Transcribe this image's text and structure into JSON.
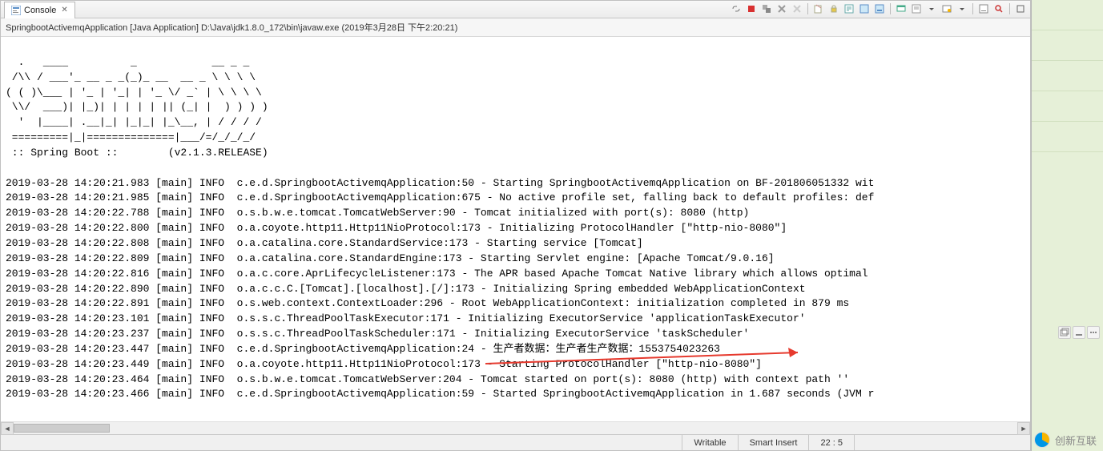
{
  "tab": {
    "label": "Console"
  },
  "run_info": "SpringbootActivemqApplication [Java Application] D:\\Java\\jdk1.8.0_172\\bin\\javaw.exe (2019年3月28日 下午2:20:21)",
  "ascii_art": [
    "  .   ____          _            __ _ _",
    " /\\\\ / ___'_ __ _ _(_)_ __  __ _ \\ \\ \\ \\",
    "( ( )\\___ | '_ | '_| | '_ \\/ _` | \\ \\ \\ \\",
    " \\\\/  ___)| |_)| | | | | || (_| |  ) ) ) )",
    "  '  |____| .__|_| |_|_| |_\\__, | / / / /",
    " =========|_|==============|___/=/_/_/_/",
    " :: Spring Boot ::        (v2.1.3.RELEASE)"
  ],
  "log_lines": [
    "2019-03-28 14:20:21.983 [main] INFO  c.e.d.SpringbootActivemqApplication:50 - Starting SpringbootActivemqApplication on BF-201806051332 wit",
    "2019-03-28 14:20:21.985 [main] INFO  c.e.d.SpringbootActivemqApplication:675 - No active profile set, falling back to default profiles: def",
    "2019-03-28 14:20:22.788 [main] INFO  o.s.b.w.e.tomcat.TomcatWebServer:90 - Tomcat initialized with port(s): 8080 (http)",
    "2019-03-28 14:20:22.800 [main] INFO  o.a.coyote.http11.Http11NioProtocol:173 - Initializing ProtocolHandler [\"http-nio-8080\"]",
    "2019-03-28 14:20:22.808 [main] INFO  o.a.catalina.core.StandardService:173 - Starting service [Tomcat]",
    "2019-03-28 14:20:22.809 [main] INFO  o.a.catalina.core.StandardEngine:173 - Starting Servlet engine: [Apache Tomcat/9.0.16]",
    "2019-03-28 14:20:22.816 [main] INFO  o.a.c.core.AprLifecycleListener:173 - The APR based Apache Tomcat Native library which allows optimal ",
    "2019-03-28 14:20:22.890 [main] INFO  o.a.c.c.C.[Tomcat].[localhost].[/]:173 - Initializing Spring embedded WebApplicationContext",
    "2019-03-28 14:20:22.891 [main] INFO  o.s.web.context.ContextLoader:296 - Root WebApplicationContext: initialization completed in 879 ms",
    "2019-03-28 14:20:23.101 [main] INFO  o.s.s.c.ThreadPoolTaskExecutor:171 - Initializing ExecutorService 'applicationTaskExecutor'",
    "2019-03-28 14:20:23.237 [main] INFO  o.s.s.c.ThreadPoolTaskScheduler:171 - Initializing ExecutorService 'taskScheduler'",
    "2019-03-28 14:20:23.447 [main] INFO  c.e.d.SpringbootActivemqApplication:24 - 生产者数据：生产者生产数据：1553754023263",
    "2019-03-28 14:20:23.449 [main] INFO  o.a.coyote.http11.Http11NioProtocol:173 - Starting ProtocolHandler [\"http-nio-8080\"]",
    "2019-03-28 14:20:23.464 [main] INFO  o.s.b.w.e.tomcat.TomcatWebServer:204 - Tomcat started on port(s): 8080 (http) with context path ''",
    "2019-03-28 14:20:23.466 [main] INFO  c.e.d.SpringbootActivemqApplication:59 - Started SpringbootActivemqApplication in 1.687 seconds (JVM r"
  ],
  "status": {
    "writable": "Writable",
    "insert_mode": "Smart Insert",
    "cursor": "22 : 5"
  },
  "watermark_text": "创新互联"
}
